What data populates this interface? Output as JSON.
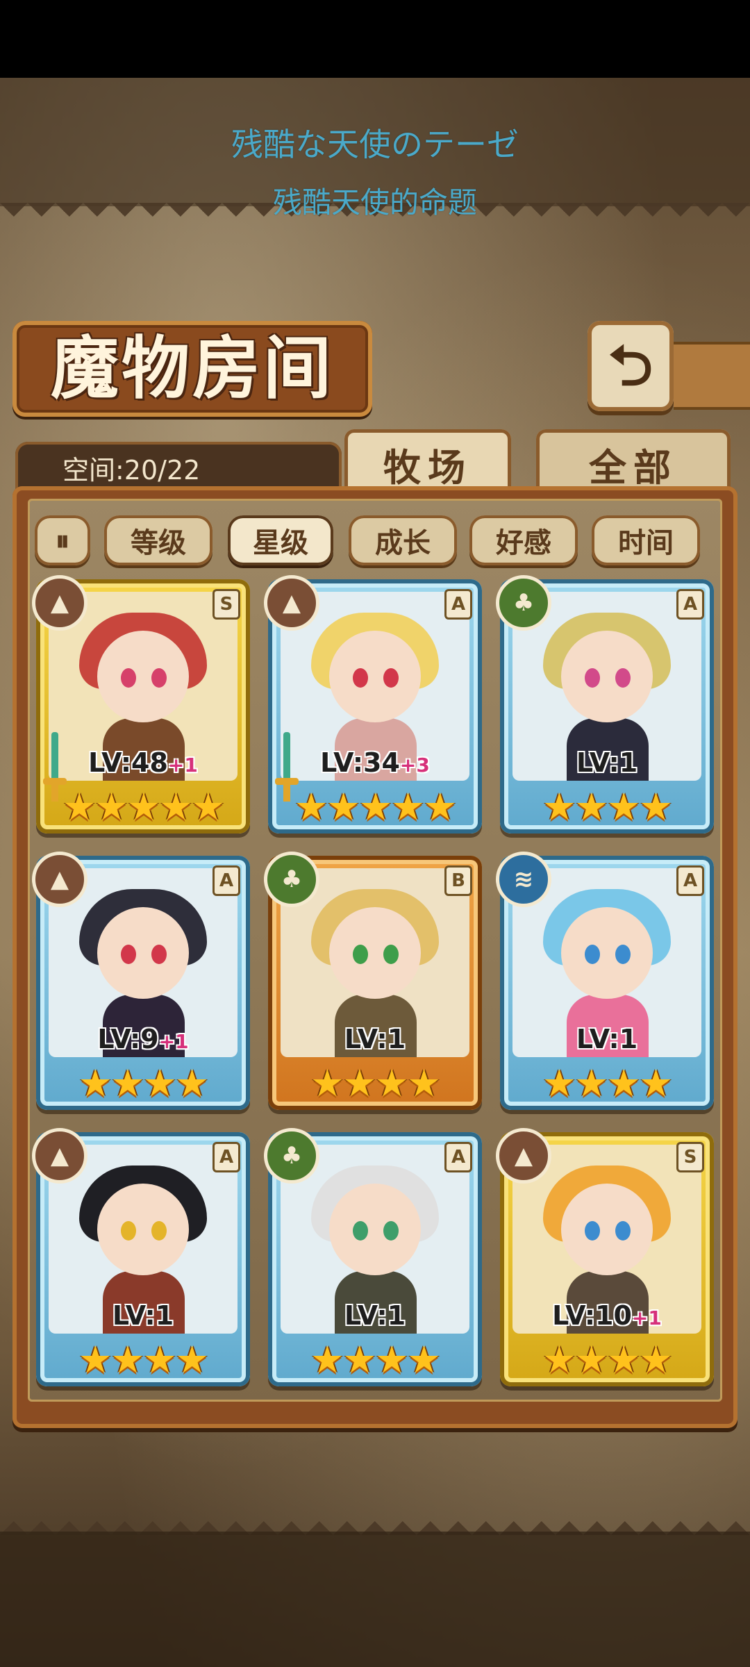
{
  "subtitles": {
    "line1": "残酷な天使のテーゼ",
    "line2": "残酷天使的命题"
  },
  "header": {
    "title": "魔物房间",
    "back_icon": "back-arrow-icon",
    "space_label": "空间:20/22"
  },
  "tabs": [
    {
      "label": "牧场",
      "selected": true
    },
    {
      "label": "全部",
      "selected": false
    }
  ],
  "sort": {
    "toggle_icon": "sort-order-icon",
    "toggle_glyph": "⏸",
    "buttons": [
      {
        "label": "等级",
        "active": false
      },
      {
        "label": "星级",
        "active": true
      },
      {
        "label": "成长",
        "active": false
      },
      {
        "label": "好感",
        "active": false
      },
      {
        "label": "时间",
        "active": false
      }
    ]
  },
  "monsters": [
    {
      "level": "LV:48",
      "plus": "+1",
      "rank": "S",
      "element": "earth",
      "stars": "★★★★★",
      "star_count": 5,
      "frame": "gold",
      "weapon": true
    },
    {
      "level": "LV:34",
      "plus": "+3",
      "rank": "A",
      "element": "earth",
      "stars": "★★★★★",
      "star_count": 5,
      "frame": "blue",
      "weapon": true
    },
    {
      "level": "LV:1",
      "plus": "",
      "rank": "A",
      "element": "plant",
      "stars": "★★★★",
      "star_count": 4,
      "frame": "blue",
      "weapon": false
    },
    {
      "level": "LV:9",
      "plus": "+1",
      "rank": "A",
      "element": "earth",
      "stars": "★★★★",
      "star_count": 4,
      "frame": "blue",
      "weapon": false
    },
    {
      "level": "LV:1",
      "plus": "",
      "rank": "B",
      "element": "plant",
      "stars": "★★★★",
      "star_count": 4,
      "frame": "orange",
      "weapon": false
    },
    {
      "level": "LV:1",
      "plus": "",
      "rank": "A",
      "element": "water",
      "stars": "★★★★",
      "star_count": 4,
      "frame": "blue",
      "weapon": false
    },
    {
      "level": "LV:1",
      "plus": "",
      "rank": "A",
      "element": "earth",
      "stars": "★★★★",
      "star_count": 4,
      "frame": "blue",
      "weapon": false
    },
    {
      "level": "LV:1",
      "plus": "",
      "rank": "A",
      "element": "plant",
      "stars": "★★★★",
      "star_count": 4,
      "frame": "blue",
      "weapon": false
    },
    {
      "level": "LV:10",
      "plus": "+1",
      "rank": "S",
      "element": "earth",
      "stars": "★★★★",
      "star_count": 4,
      "frame": "gold",
      "weapon": false
    }
  ],
  "colors": {
    "subtitle": "#4aa9c9",
    "gold_frame": "#f6d64a",
    "blue_frame": "#9fd8ee",
    "orange_frame": "#f0a547",
    "star": "#ffc21c",
    "plus": "#d6307a"
  }
}
